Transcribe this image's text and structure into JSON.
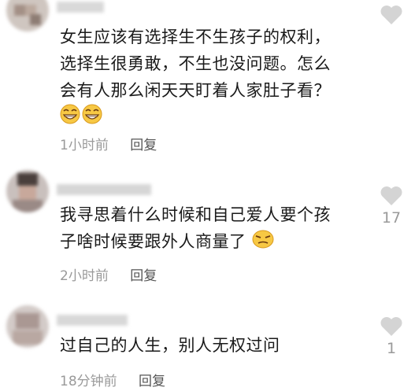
{
  "comments": [
    {
      "text_lines": [
        "女生应该有选择生不生孩子的权利，",
        "选择生很勇敢，不生也没问题。怎么",
        "会有人那么闲天天盯着人家肚子看？"
      ],
      "emojis": [
        "grin-emoji",
        "grin-emoji"
      ],
      "time": "1小时前",
      "reply": "回复",
      "likes": ""
    },
    {
      "text_lines": [
        "我寻思着什么时候和自己爱人要个孩",
        "子啥时候要跟外人商量了"
      ],
      "emojis": [
        "smirk-emoji"
      ],
      "time": "2小时前",
      "reply": "回复",
      "likes": "17"
    },
    {
      "text_lines": [
        "过自己的人生，别人无权过问"
      ],
      "emojis": [],
      "time": "18分钟前",
      "reply": "回复",
      "likes": "1"
    }
  ],
  "colors": {
    "like_icon": "#d4d4d4",
    "meta_text": "#9a9a9a",
    "reply_text": "#555555"
  }
}
